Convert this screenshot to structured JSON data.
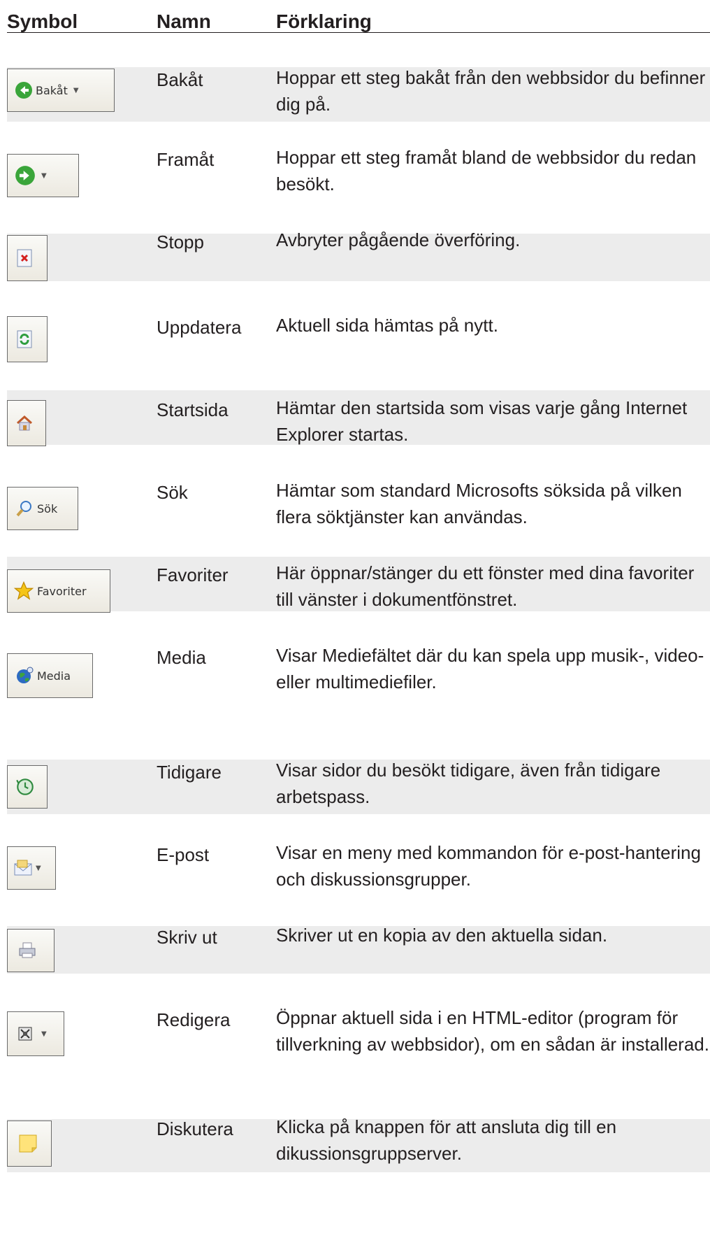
{
  "header": {
    "symbol": "Symbol",
    "name": "Namn",
    "description": "Förklaring"
  },
  "rows": [
    {
      "name": "Bakåt",
      "description": "Hoppar ett steg bakåt från den webbsidor du befinner dig på.",
      "button_label": "Bakåt",
      "icon": "back-arrow-icon"
    },
    {
      "name": "Framåt",
      "description": "Hoppar ett steg framåt bland de webbsidor du redan besökt.",
      "button_label": "",
      "icon": "forward-arrow-icon"
    },
    {
      "name": "Stopp",
      "description": "Avbryter pågående överföring.",
      "button_label": "",
      "icon": "stop-icon"
    },
    {
      "name": "Uppdatera",
      "description": "Aktuell sida hämtas på nytt.",
      "button_label": "",
      "icon": "refresh-icon"
    },
    {
      "name": "Startsida",
      "description": "Hämtar den startsida som visas varje gång Internet Explorer startas.",
      "button_label": "",
      "icon": "home-icon"
    },
    {
      "name": "Sök",
      "description": "Hämtar som standard Microsofts söksida på vilken flera söktjänster kan användas.",
      "button_label": "Sök",
      "icon": "search-icon"
    },
    {
      "name": "Favoriter",
      "description": "Här öppnar/stänger du ett fönster med dina favoriter till vänster i dokumentfönstret.",
      "button_label": "Favoriter",
      "icon": "star-icon"
    },
    {
      "name": "Media",
      "description": "Visar Mediefältet där du kan spela upp musik-, video- eller multimediefiler.",
      "button_label": "Media",
      "icon": "media-globe-icon"
    },
    {
      "name": "Tidigare",
      "description": "Visar sidor du besökt tidigare, även från tidigare arbetspass.",
      "button_label": "",
      "icon": "history-icon"
    },
    {
      "name": "E-post",
      "description": "Visar en meny med kommandon för e-post-hantering och diskussionsgrupper.",
      "button_label": "",
      "icon": "mail-icon"
    },
    {
      "name": "Skriv ut",
      "description": "Skriver ut en kopia av den aktuella sidan.",
      "button_label": "",
      "icon": "printer-icon"
    },
    {
      "name": "Redigera",
      "description": "Öppnar aktuell sida i en HTML-editor (program för tillverkning av webbsidor), om en sådan är installerad.",
      "button_label": "",
      "icon": "edit-icon"
    },
    {
      "name": "Diskutera",
      "description": "Klicka på knappen för att ansluta dig till en dikussionsgruppserver.",
      "button_label": "",
      "icon": "discuss-note-icon"
    }
  ]
}
